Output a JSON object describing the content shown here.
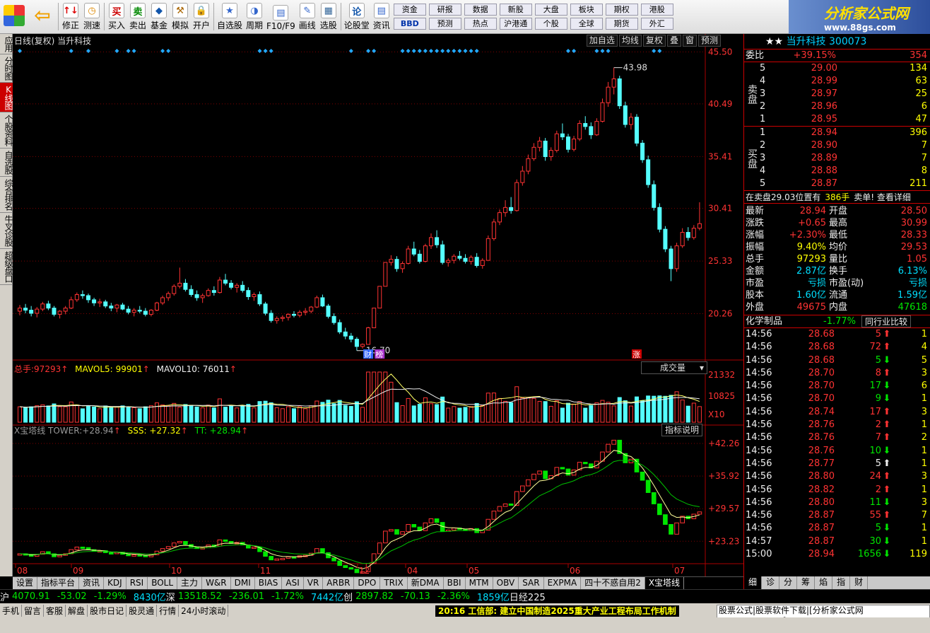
{
  "toolbar": {
    "items": [
      {
        "label": "修正",
        "icon": "↑↓"
      },
      {
        "label": "测速",
        "icon": "◷"
      },
      {
        "label": "买入",
        "icon": "买"
      },
      {
        "label": "卖出",
        "icon": "卖"
      },
      {
        "label": "基金",
        "icon": "◆"
      },
      {
        "label": "模拟",
        "icon": "⚒"
      },
      {
        "label": "开户",
        "icon": "🔒"
      },
      {
        "label": "自选股",
        "icon": "★"
      },
      {
        "label": "周期",
        "icon": "◑"
      },
      {
        "label": "F10/F9",
        "icon": "▤"
      },
      {
        "label": "画线",
        "icon": "✎"
      },
      {
        "label": "选股",
        "icon": "▦"
      },
      {
        "label": "论股堂",
        "icon": "论"
      },
      {
        "label": "资讯",
        "icon": "▤"
      }
    ],
    "mini_groups": [
      [
        "资金",
        "BBD"
      ],
      [
        "研报",
        "预测"
      ],
      [
        "数据",
        "热点"
      ],
      [
        "新股",
        "沪港通"
      ],
      [
        "大盘",
        "个股"
      ],
      [
        "板块",
        "全球"
      ],
      [
        "期权",
        "期货"
      ],
      [
        "港股",
        "外汇"
      ]
    ],
    "data_label": "数据",
    "hot_label": "热点",
    "ipo_label": "新股",
    "hk_label": "沪港通"
  },
  "logo": {
    "line1": "分析家公式网",
    "line2": "www.88gs.com"
  },
  "left_tabs": [
    "应用",
    "分时图",
    "K线图",
    "个股资料",
    "自选股",
    "综合排名",
    "牛叉诊股",
    "超级盘口"
  ],
  "chart": {
    "title": "日线(复权) 当升科技",
    "top_buttons": [
      "加自选",
      "均线",
      "复权",
      "叠",
      "窗",
      "预测"
    ],
    "price_labels": [
      "45.50",
      "40.49",
      "35.41",
      "30.41",
      "25.33",
      "20.26"
    ],
    "high_label": "43.98",
    "low_label": "16.70",
    "badges": [
      "财",
      "榜",
      "涨"
    ],
    "vol_header": {
      "total_label": "总手:",
      "total": "97293",
      "ma5_label": "MAVOL5:",
      "ma5": "99901",
      "ma10_label": "MAVOL10:",
      "ma10": "76011"
    },
    "vol_select": "成交量",
    "vol_labels": [
      "21332",
      "10825",
      "X10"
    ],
    "ind_header": {
      "name": "X宝塔线 TOWER:",
      "tower": "+28.94",
      "sss_label": "SSS:",
      "sss": "+27.32",
      "tt_label": "TT:",
      "tt": "+28.94"
    },
    "ind_button": "指标说明",
    "ind_labels": [
      "+42.26",
      "+35.92",
      "+29.57",
      "+23.23"
    ],
    "months": [
      "08",
      "09",
      "10",
      "11",
      "12",
      "04",
      "05",
      "06",
      "07"
    ]
  },
  "chart_data": {
    "type": "candlestick",
    "title": "日线(复权) 当升科技",
    "ylim": [
      16.0,
      46.0
    ],
    "high": 43.98,
    "low": 16.7,
    "candles": [
      [
        20.5,
        21.1,
        20.1,
        20.8
      ],
      [
        20.8,
        21.2,
        20.3,
        20.6
      ],
      [
        20.6,
        21.0,
        20.0,
        20.3
      ],
      [
        20.3,
        20.9,
        19.9,
        20.7
      ],
      [
        20.7,
        21.4,
        20.5,
        21.2
      ],
      [
        21.2,
        21.5,
        20.6,
        20.8
      ],
      [
        20.8,
        21.0,
        20.0,
        20.2
      ],
      [
        20.2,
        20.6,
        19.8,
        20.5
      ],
      [
        20.5,
        21.0,
        20.2,
        20.8
      ],
      [
        20.8,
        21.9,
        20.7,
        21.6
      ],
      [
        21.6,
        22.3,
        21.4,
        22.1
      ],
      [
        22.1,
        22.5,
        21.7,
        22.0
      ],
      [
        22.0,
        22.2,
        21.3,
        21.6
      ],
      [
        21.6,
        21.8,
        21.0,
        21.3
      ],
      [
        21.3,
        21.7,
        20.9,
        21.4
      ],
      [
        21.4,
        21.6,
        20.8,
        21.0
      ],
      [
        21.0,
        21.3,
        20.5,
        20.8
      ],
      [
        20.8,
        21.2,
        20.4,
        21.1
      ],
      [
        21.1,
        21.3,
        20.6,
        20.7
      ],
      [
        20.7,
        21.0,
        20.2,
        20.4
      ],
      [
        20.4,
        20.8,
        20.0,
        20.6
      ],
      [
        20.6,
        21.0,
        20.3,
        20.5
      ],
      [
        20.5,
        20.8,
        20.0,
        20.2
      ],
      [
        20.2,
        20.7,
        20.0,
        20.6
      ],
      [
        20.6,
        21.4,
        20.5,
        21.3
      ],
      [
        21.3,
        22.0,
        21.1,
        21.8
      ],
      [
        21.8,
        22.4,
        21.5,
        22.2
      ],
      [
        22.2,
        23.1,
        22.0,
        22.9
      ],
      [
        22.9,
        24.7,
        22.7,
        23.2
      ],
      [
        23.2,
        23.6,
        22.4,
        22.6
      ],
      [
        22.6,
        23.0,
        21.9,
        22.1
      ],
      [
        22.1,
        22.5,
        21.5,
        21.8
      ],
      [
        21.8,
        22.2,
        21.3,
        22.0
      ],
      [
        22.0,
        22.7,
        21.9,
        22.5
      ],
      [
        22.5,
        22.9,
        22.0,
        22.3
      ],
      [
        22.3,
        23.8,
        22.2,
        23.5
      ],
      [
        23.5,
        24.1,
        23.0,
        23.2
      ],
      [
        23.2,
        23.5,
        22.6,
        22.8
      ],
      [
        22.8,
        23.2,
        22.3,
        23.0
      ],
      [
        23.0,
        23.4,
        22.3,
        22.5
      ],
      [
        22.5,
        22.8,
        21.6,
        21.9
      ],
      [
        21.9,
        22.3,
        21.5,
        22.1
      ],
      [
        22.1,
        22.4,
        21.0,
        21.2
      ],
      [
        21.2,
        21.4,
        20.1,
        20.3
      ],
      [
        20.3,
        20.6,
        19.4,
        19.6
      ],
      [
        19.6,
        20.0,
        19.3,
        19.8
      ],
      [
        19.8,
        20.1,
        19.5,
        19.9
      ],
      [
        19.9,
        20.3,
        19.6,
        20.2
      ],
      [
        20.2,
        20.5,
        19.9,
        20.1
      ],
      [
        20.1,
        20.6,
        19.9,
        20.4
      ],
      [
        20.4,
        20.8,
        20.1,
        20.5
      ],
      [
        20.5,
        21.0,
        20.3,
        20.9
      ],
      [
        20.9,
        22.0,
        20.8,
        21.8
      ],
      [
        21.8,
        22.1,
        20.9,
        21.0
      ],
      [
        21.0,
        21.2,
        19.8,
        20.0
      ],
      [
        20.0,
        20.3,
        19.2,
        19.4
      ],
      [
        19.4,
        19.7,
        18.3,
        18.5
      ],
      [
        18.5,
        18.9,
        17.8,
        18.1
      ],
      [
        18.1,
        18.4,
        17.5,
        17.8
      ],
      [
        17.8,
        18.0,
        16.7,
        17.1
      ],
      [
        17.1,
        17.4,
        16.9,
        17.3
      ],
      [
        17.3,
        19.0,
        17.3,
        18.9
      ],
      [
        18.9,
        20.8,
        18.9,
        20.8
      ],
      [
        20.8,
        22.9,
        20.8,
        22.9
      ],
      [
        22.9,
        25.2,
        22.9,
        25.2
      ],
      [
        25.2,
        25.9,
        24.9,
        25.5
      ],
      [
        25.5,
        25.8,
        24.3,
        24.6
      ],
      [
        24.6,
        25.3,
        24.2,
        25.1
      ],
      [
        25.1,
        26.8,
        25.0,
        26.5
      ],
      [
        26.5,
        27.2,
        25.8,
        26.0
      ],
      [
        26.0,
        26.4,
        25.1,
        25.3
      ],
      [
        25.3,
        27.0,
        25.2,
        26.8
      ],
      [
        26.8,
        28.0,
        26.5,
        27.6
      ],
      [
        27.6,
        28.3,
        26.6,
        26.9
      ],
      [
        26.9,
        27.3,
        25.0,
        25.2
      ],
      [
        25.2,
        25.6,
        24.8,
        25.4
      ],
      [
        25.4,
        26.0,
        25.1,
        25.8
      ],
      [
        25.8,
        26.3,
        25.4,
        25.6
      ],
      [
        25.6,
        26.0,
        25.1,
        25.3
      ],
      [
        25.3,
        25.9,
        25.0,
        25.7
      ],
      [
        25.7,
        26.1,
        24.7,
        24.9
      ],
      [
        24.9,
        25.6,
        24.6,
        25.4
      ],
      [
        25.4,
        27.8,
        25.4,
        27.5
      ],
      [
        27.5,
        29.4,
        27.3,
        29.1
      ],
      [
        29.1,
        30.3,
        28.8,
        30.0
      ],
      [
        30.0,
        31.2,
        29.6,
        30.5
      ],
      [
        30.5,
        31.5,
        29.9,
        30.2
      ],
      [
        30.2,
        33.2,
        30.1,
        32.9
      ],
      [
        32.9,
        34.5,
        32.6,
        34.0
      ],
      [
        34.0,
        35.6,
        33.7,
        35.2
      ],
      [
        35.2,
        36.7,
        35.0,
        36.3
      ],
      [
        36.3,
        37.3,
        35.9,
        36.9
      ],
      [
        36.9,
        37.2,
        35.0,
        35.4
      ],
      [
        35.4,
        36.3,
        35.0,
        36.0
      ],
      [
        36.0,
        37.9,
        35.8,
        37.6
      ],
      [
        37.6,
        38.6,
        37.0,
        37.3
      ],
      [
        37.3,
        37.6,
        35.8,
        36.1
      ],
      [
        36.1,
        37.4,
        35.9,
        37.1
      ],
      [
        37.1,
        38.9,
        36.9,
        38.6
      ],
      [
        38.6,
        39.3,
        38.0,
        38.3
      ],
      [
        38.3,
        38.7,
        37.1,
        37.5
      ],
      [
        37.5,
        39.1,
        37.4,
        38.8
      ],
      [
        38.8,
        41.0,
        38.7,
        40.6
      ],
      [
        40.6,
        42.6,
        40.2,
        42.1
      ],
      [
        42.1,
        43.98,
        41.4,
        42.9
      ],
      [
        42.9,
        43.2,
        40.0,
        40.3
      ],
      [
        40.3,
        40.7,
        38.2,
        38.5
      ],
      [
        38.5,
        39.6,
        38.0,
        39.2
      ],
      [
        39.2,
        39.5,
        36.4,
        36.7
      ],
      [
        36.7,
        37.0,
        34.8,
        35.1
      ],
      [
        35.1,
        35.5,
        32.4,
        32.7
      ],
      [
        32.7,
        33.1,
        30.2,
        30.5
      ],
      [
        30.5,
        30.9,
        28.1,
        28.4
      ],
      [
        28.4,
        28.7,
        26.2,
        26.5
      ],
      [
        26.5,
        26.8,
        23.4,
        24.6
      ],
      [
        24.6,
        27.1,
        24.3,
        26.8
      ],
      [
        26.8,
        28.5,
        26.6,
        28.1
      ],
      [
        28.1,
        28.6,
        27.3,
        27.6
      ],
      [
        27.6,
        28.8,
        27.4,
        28.5
      ],
      [
        28.5,
        31.0,
        28.3,
        28.94
      ]
    ],
    "volume": {
      "latest": 97293,
      "ma5": 99901,
      "ma10": 76011,
      "max_label": 21332,
      "mid_label": 10825,
      "unit": "X10"
    },
    "indicator": {
      "name": "X宝塔线",
      "tower": 28.94,
      "sss": 27.32,
      "tt": 28.94,
      "ylim": [
        19.0,
        43.5
      ]
    }
  },
  "bottom_tabs": [
    "设置",
    "指标平台",
    "资讯",
    "KDJ",
    "RSI",
    "BOLL",
    "主力",
    "W&R",
    "DMI",
    "BIAS",
    "ASI",
    "VR",
    "ARBR",
    "DPO",
    "TRIX",
    "新DMA",
    "BBI",
    "MTM",
    "OBV",
    "SAR",
    "EXPMA",
    "四十不惑自用2",
    "X宝塔线"
  ],
  "right_panel": {
    "title": "当升科技 300073",
    "weibi": {
      "label": "委比",
      "pct": "+39.15%",
      "diff": "354"
    },
    "sell_label": "卖盘",
    "sells": [
      {
        "n": "5",
        "p": "29.00",
        "v": "134"
      },
      {
        "n": "4",
        "p": "28.99",
        "v": "63"
      },
      {
        "n": "3",
        "p": "28.97",
        "v": "25"
      },
      {
        "n": "2",
        "p": "28.96",
        "v": "6"
      },
      {
        "n": "1",
        "p": "28.95",
        "v": "47"
      }
    ],
    "buy_label": "买盘",
    "buys": [
      {
        "n": "1",
        "p": "28.94",
        "v": "396"
      },
      {
        "n": "2",
        "p": "28.90",
        "v": "7"
      },
      {
        "n": "3",
        "p": "28.89",
        "v": "7"
      },
      {
        "n": "4",
        "p": "28.88",
        "v": "8"
      },
      {
        "n": "5",
        "p": "28.87",
        "v": "211"
      }
    ],
    "notice": {
      "text": "在卖盘29.03位置有",
      "qty": "386手",
      "tail": "卖单! 查看详细"
    },
    "stats": [
      [
        "最新",
        "28.94",
        "开盘",
        "28.50"
      ],
      [
        "涨跌",
        "+0.65",
        "最高",
        "30.99"
      ],
      [
        "涨幅",
        "+2.30%",
        "最低",
        "28.33"
      ],
      [
        "振幅",
        "9.40%",
        "均价",
        "29.53"
      ],
      [
        "总手",
        "97293",
        "量比",
        "1.05"
      ],
      [
        "金额",
        "2.87亿",
        "换手",
        "6.13%"
      ],
      [
        "市盈",
        "亏损",
        "市盈(动)",
        "亏损"
      ],
      [
        "股本",
        "1.60亿",
        "流通",
        "1.59亿"
      ],
      [
        "外盘",
        "49675",
        "内盘",
        "47618"
      ]
    ],
    "industry": {
      "name": "化学制品",
      "pct": "-1.77%",
      "button": "同行业比较"
    },
    "ticks": [
      [
        "14:56",
        "28.68",
        "5",
        "1"
      ],
      [
        "14:56",
        "28.68",
        "72",
        "4"
      ],
      [
        "14:56",
        "28.68",
        "5",
        "5"
      ],
      [
        "14:56",
        "28.70",
        "8",
        "3"
      ],
      [
        "14:56",
        "28.70",
        "17",
        "6"
      ],
      [
        "14:56",
        "28.70",
        "9",
        "1"
      ],
      [
        "14:56",
        "28.74",
        "17",
        "3"
      ],
      [
        "14:56",
        "28.76",
        "2",
        "1"
      ],
      [
        "14:56",
        "28.76",
        "7",
        "2"
      ],
      [
        "14:56",
        "28.76",
        "10",
        "1"
      ],
      [
        "14:56",
        "28.77",
        "5",
        "1"
      ],
      [
        "14:56",
        "28.80",
        "24",
        "3"
      ],
      [
        "14:56",
        "28.82",
        "2",
        "1"
      ],
      [
        "14:56",
        "28.80",
        "11",
        "3"
      ],
      [
        "14:56",
        "28.87",
        "55",
        "7"
      ],
      [
        "14:56",
        "28.87",
        "5",
        "1"
      ],
      [
        "14:57",
        "28.87",
        "30",
        "1"
      ],
      [
        "15:00",
        "28.94",
        "1656",
        "119"
      ]
    ],
    "bottom_tabs": [
      "细",
      "诊",
      "分",
      "筹",
      "焰",
      "指",
      "财"
    ]
  },
  "status": {
    "sh": {
      "label": "沪",
      "index": "4070.91",
      "chg": "-53.02",
      "pct": "-1.29%",
      "amt": "8430亿"
    },
    "sz": {
      "label": "深",
      "index": "13518.52",
      "chg": "-236.01",
      "pct": "-1.72%",
      "amt": "7442亿"
    },
    "cy": {
      "label": "创",
      "index": "2897.82",
      "chg": "-70.13",
      "pct": "-2.36%",
      "amt": "1859亿"
    },
    "rj": {
      "label": "日经225"
    }
  },
  "status2": {
    "items": [
      "手机",
      "留言",
      "客服",
      "解盘",
      "股市日记",
      "股灵通",
      "行情",
      "24小时滚动"
    ],
    "news": "20:16 工信部: 建立中国制造2025重大产业工程布局工作机制",
    "ad": "股票公式|股票软件下载|[分析家公式网www.88gs.com]"
  }
}
